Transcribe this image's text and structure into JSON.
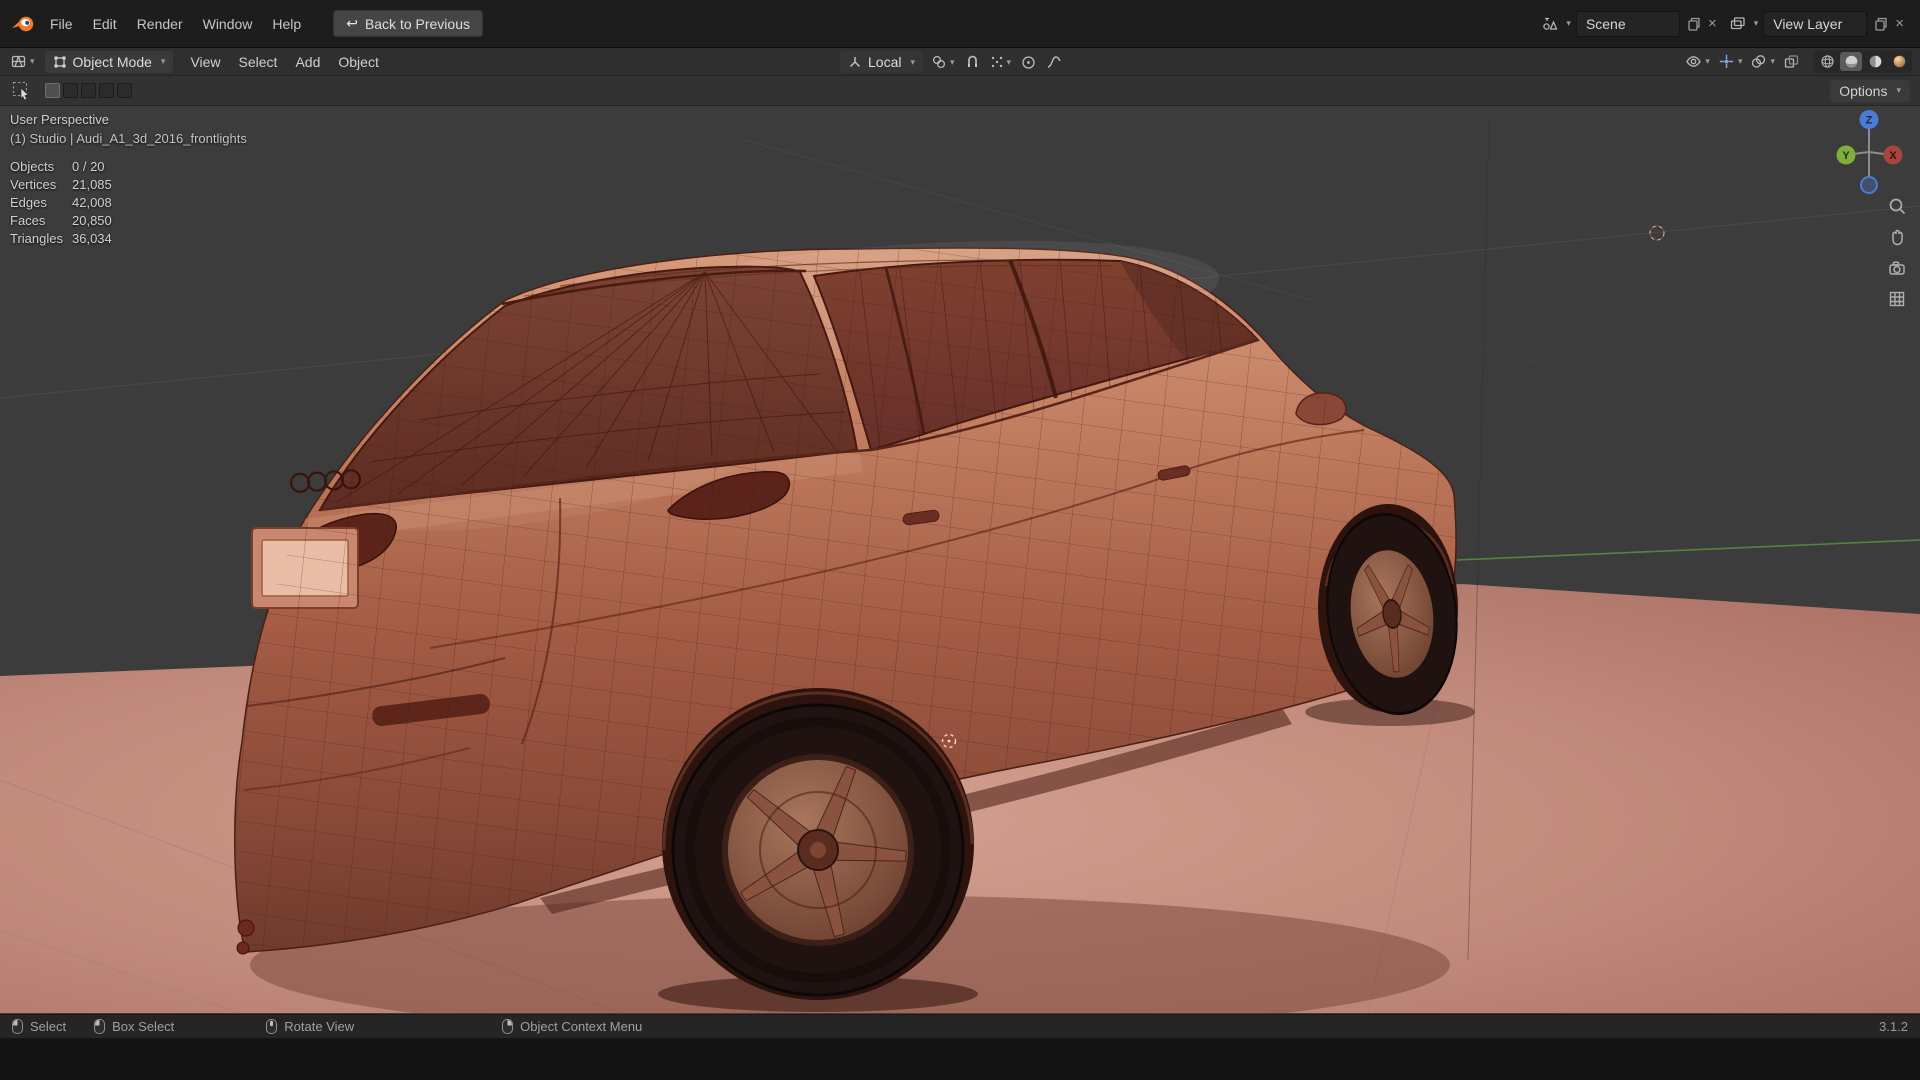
{
  "icons": {
    "caret": "▾",
    "back_arrow": "↩",
    "close": "×"
  },
  "topbar": {
    "menus": [
      "File",
      "Edit",
      "Render",
      "Window",
      "Help"
    ],
    "back_button": "Back to Previous",
    "scene": {
      "label": "Scene"
    },
    "view_layer": {
      "label": "View Layer"
    }
  },
  "header": {
    "mode": "Object Mode",
    "menus": [
      "View",
      "Select",
      "Add",
      "Object"
    ],
    "orientation": "Local"
  },
  "toolstrip": {
    "options": "Options"
  },
  "viewport": {
    "perspective": "User Perspective",
    "scene_info": "(1) Studio | Audi_A1_3d_2016_frontlights",
    "stats": [
      {
        "label": "Objects",
        "value": "0 / 20"
      },
      {
        "label": "Vertices",
        "value": "21,085"
      },
      {
        "label": "Edges",
        "value": "42,008"
      },
      {
        "label": "Faces",
        "value": "20,850"
      },
      {
        "label": "Triangles",
        "value": "36,034"
      }
    ],
    "gizmo": {
      "x": "X",
      "y": "Y",
      "z": "Z"
    }
  },
  "statusbar": {
    "hints": [
      {
        "label": "Select"
      },
      {
        "label": "Box Select"
      },
      {
        "label": "Rotate View"
      },
      {
        "label": "Object Context Menu"
      }
    ],
    "version": "3.1.2"
  },
  "colors": {
    "accent_blue": "#4772b3",
    "viewport_bg": "#3c3c3c",
    "floor": "#c18a7b",
    "car_clay": "#a35b44",
    "wireframe": "#3a150e"
  }
}
